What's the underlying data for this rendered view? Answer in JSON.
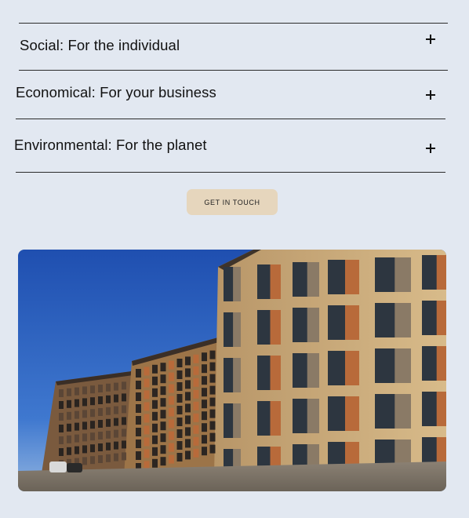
{
  "accordion": {
    "items": [
      {
        "title": "Social: For the individual",
        "icon": "plus-icon"
      },
      {
        "title": "Economical: For your business",
        "icon": "plus-icon"
      },
      {
        "title": "Environmental: For the planet",
        "icon": "plus-icon"
      }
    ]
  },
  "cta": {
    "label": "GET IN TOUCH"
  },
  "photo": {
    "subject": "building-photo",
    "colors": {
      "sky": "#2156b8",
      "brick": "#c9a873",
      "wood": "#b86a3a"
    }
  }
}
